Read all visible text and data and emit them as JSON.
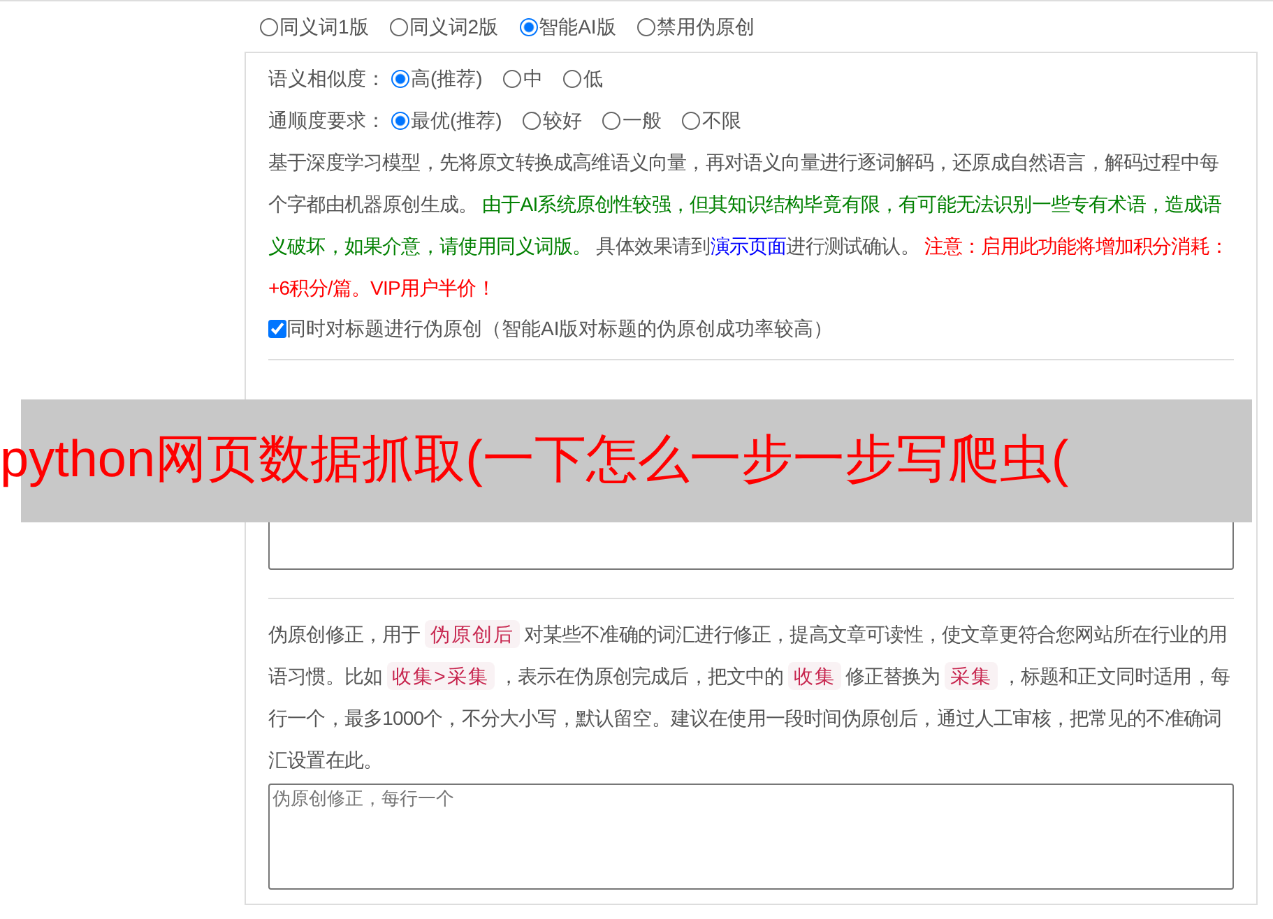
{
  "modes": [
    {
      "label": "同义词1版",
      "selected": false
    },
    {
      "label": "同义词2版",
      "selected": false
    },
    {
      "label": "智能AI版",
      "selected": true
    },
    {
      "label": "禁用伪原创",
      "selected": false
    }
  ],
  "settings": [
    {
      "label": "语义相似度：",
      "options": [
        {
          "label": "高(推荐)",
          "selected": true
        },
        {
          "label": "中",
          "selected": false
        },
        {
          "label": "低",
          "selected": false
        }
      ]
    },
    {
      "label": "通顺度要求：",
      "options": [
        {
          "label": "最优(推荐)",
          "selected": true
        },
        {
          "label": "较好",
          "selected": false
        },
        {
          "label": "一般",
          "selected": false
        },
        {
          "label": "不限",
          "selected": false
        }
      ]
    }
  ],
  "description": [
    {
      "kind": "plain",
      "text": "基于深度学习模型，先将原文转换成高维语义向量，再对语义向量进行逐词解码，还原成自然语言，解码过程中每个字都由机器原创生成。 "
    },
    {
      "kind": "success",
      "text": "由于AI系统原创性较强，但其知识结构毕竟有限，有可能无法识别一些专有术语，造成语义破坏，如果介意，请使用同义词版。"
    },
    {
      "kind": "plain",
      "text": " 具体效果请到"
    },
    {
      "kind": "link",
      "text": "演示页面"
    },
    {
      "kind": "plain",
      "text": "进行测试确认。 "
    },
    {
      "kind": "warning",
      "text": "注意：启用此功能将增加积分消耗：+6积分/篇。VIP用户半价！"
    }
  ],
  "title_option": {
    "label": "同时对标题进行伪原创（智能AI版对标题的伪原创成功率较高）",
    "checked": true
  },
  "correction": {
    "parts": [
      {
        "kind": "plain",
        "text": "伪原创修正，用于"
      },
      {
        "kind": "code",
        "text": "伪原创后"
      },
      {
        "kind": "plain",
        "text": "对某些不准确的词汇进行修正，提高文章可读性，使文章更符合您网站所在行业的用语习惯。比如"
      },
      {
        "kind": "code",
        "text": "收集>采集"
      },
      {
        "kind": "plain",
        "text": "，表示在伪原创完成后，把文中的"
      },
      {
        "kind": "code",
        "text": "收集"
      },
      {
        "kind": "plain",
        "text": "修正替换为"
      },
      {
        "kind": "code",
        "text": "采集"
      },
      {
        "kind": "plain",
        "text": "，标题和正文同时适用，每行一个，最多1000个，不分大小写，默认留空。建议在使用一段时间伪原创后，通过人工审核，把常见的不准确词汇设置在此。"
      }
    ],
    "placeholder": "伪原创修正，每行一个"
  },
  "banner": {
    "title": "python网页数据抓取(一下怎么一步一步写爬虫("
  }
}
